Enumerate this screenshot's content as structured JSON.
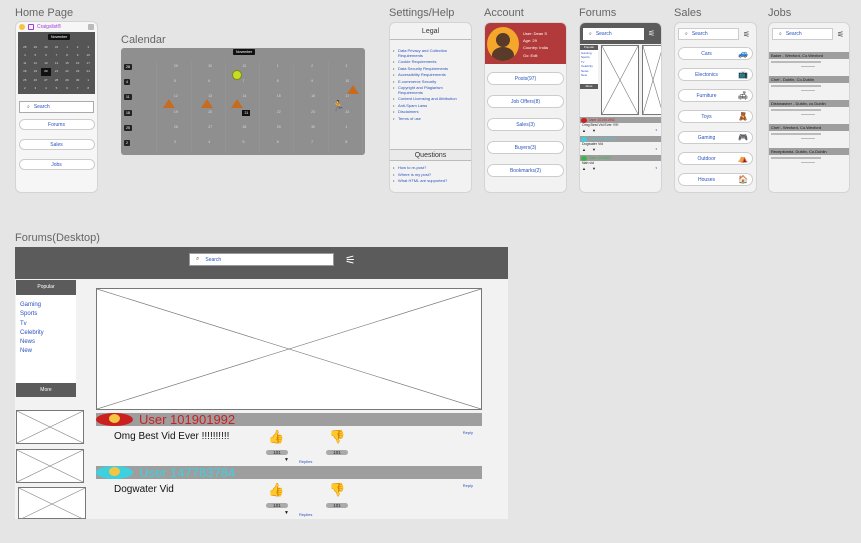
{
  "labels": {
    "home": "Home Page",
    "calendar": "Calendar",
    "settings": "Settings/Help",
    "account": "Account",
    "forums": "Forums",
    "sales": "Sales",
    "jobs": "Jobs",
    "forums_desktop": "Forums(Desktop)"
  },
  "home": {
    "app_name": "Craigslist®",
    "month": "November",
    "search_placeholder": "Search",
    "buttons": [
      "Forums",
      "Sales",
      "Jobs"
    ]
  },
  "calendar": {
    "month": "November",
    "row_dates": [
      [
        "28",
        "29",
        "30",
        "31",
        "1",
        "2",
        "3"
      ],
      [
        "4",
        "5",
        "6",
        "7",
        "8",
        "9",
        "10"
      ],
      [
        "11",
        "12",
        "13",
        "14",
        "15",
        "16",
        "17"
      ],
      [
        "18",
        "19",
        "20",
        "21",
        "22",
        "23",
        "24"
      ],
      [
        "25",
        "26",
        "27",
        "28",
        "29",
        "30",
        "1"
      ],
      [
        "2",
        "3",
        "4",
        "5",
        "6",
        "7",
        "8"
      ]
    ]
  },
  "settings": {
    "legal_title": "Legal",
    "legal_items": [
      "Data Privacy and Collection Requirements",
      "Cookie Requirements",
      "Data Security Requirements",
      "Accessibility Requirements",
      "E-commerce Security",
      "Copyright and Plagiarism Requirements",
      "Content Licensing and Attribution",
      "Anti-Spam Laws",
      "Disclaimers",
      "Terms of use"
    ],
    "questions_title": "Questions",
    "question_items": [
      "How to re-post?",
      "Where is my post?",
      "What HTML are supported?"
    ]
  },
  "account": {
    "user": "User: Dean S",
    "age": "Age: 29",
    "country": "Country: India",
    "edit": "Go: Edit",
    "buttons": [
      "Posts(97)",
      "Job Offers(8)",
      "Sales(3)",
      "Buyers(3)",
      "Bookmarks(2)"
    ]
  },
  "forums": {
    "search_placeholder": "Search",
    "popular": "Popular",
    "topics": [
      "Gaming",
      "Sports",
      "Tv",
      "Celebrity",
      "News",
      "New"
    ],
    "more": "More",
    "posts": [
      {
        "user": "User 101901992",
        "title": "Omg Best Vid Ever !!!!!!!!!!",
        "likes": "101",
        "dislikes": "101",
        "replies": "Replies",
        "reply": "Reply",
        "color": "#cc1f1f"
      },
      {
        "user": "User 147783784",
        "title": "Dogwater Vid",
        "likes": "101",
        "dislikes": "101",
        "replies": "Replies",
        "reply": "Reply",
        "color": "#3fd0e0"
      }
    ],
    "mobile_posts": [
      {
        "user": "User 101901992",
        "title": "Omg Best Vid Ever !!!!!!",
        "color": "#cc1f1f"
      },
      {
        "user": "User 147783784",
        "title": "Dogwater Vid",
        "color": "#3fd0e0"
      },
      {
        "user": "User 1234567",
        "title": "Nah vid",
        "color": "#3bb54a"
      }
    ]
  },
  "sales": {
    "search_placeholder": "Search",
    "categories": [
      "Cars",
      "Electonics",
      "Furniture",
      "Toys",
      "Gaming",
      "Outdoor",
      "Houses"
    ]
  },
  "jobs": {
    "search_placeholder": "Search",
    "listings": [
      "Baker - Wexford, Co.Wexford",
      "Chef - Dublin, Co.Dublin",
      "Dishwasher - Dublin, co.Dublin",
      "Chef - Wexford, Co.Wexford",
      "Receptionist- Dublin, Co.Dublin"
    ]
  },
  "colors": {
    "dark_header": "#5b5b5b",
    "account_header": "#b23a3a",
    "link": "#2a52be",
    "grey_band": "#9e9e9e"
  }
}
